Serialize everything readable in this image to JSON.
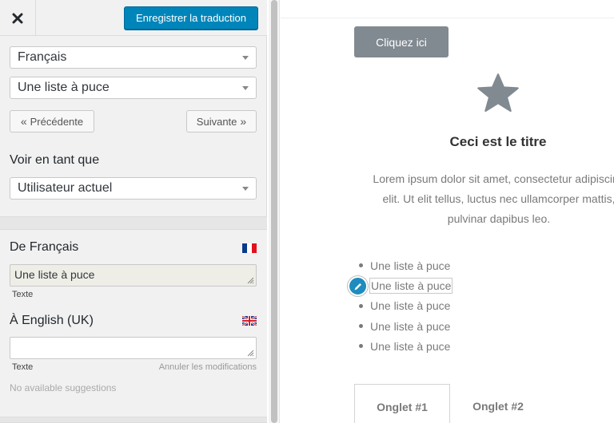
{
  "toolbar": {
    "save_label": "Enregistrer la traduction"
  },
  "selectors": {
    "language": "Français",
    "string": "Une liste à puce",
    "view_as_label": "Voir en tant que",
    "view_as": "Utilisateur actuel"
  },
  "navigation": {
    "previous_label": "Précédente",
    "next_label": "Suivante"
  },
  "source": {
    "heading": "De Français",
    "value": "Une liste à puce",
    "type_label": "Texte"
  },
  "target": {
    "heading": "À English (UK)",
    "value": "",
    "type_label": "Texte",
    "discard_label": "Annuler les modifications",
    "suggestions_label": "No available suggestions"
  },
  "preview": {
    "button_label": "Cliquez ici",
    "title": "Ceci est le titre",
    "paragraph_lines": [
      "Lorem ipsum dolor sit amet, consectetur adipiscing",
      "elit. Ut elit tellus, luctus nec ullamcorper mattis,",
      "pulvinar dapibus leo."
    ],
    "list_items": [
      "Une liste à puce",
      "Une liste à puce",
      "Une liste à puce",
      "Une liste à puce",
      "Une liste à puce"
    ],
    "selected_list_index": 1,
    "tabs": [
      "Onglet #1",
      "Onglet #2"
    ]
  },
  "colors": {
    "primary": "#0085ba",
    "edit_pin": "#1e8cbe",
    "cta_button": "#818a91",
    "star": "#818a91"
  },
  "icons": {
    "close": "close-icon",
    "previous": "double-chevron-left-icon",
    "next": "double-chevron-right-icon",
    "source_flag": "flag-france-icon",
    "target_flag": "flag-uk-icon",
    "star": "star-icon",
    "edit": "pencil-icon"
  }
}
